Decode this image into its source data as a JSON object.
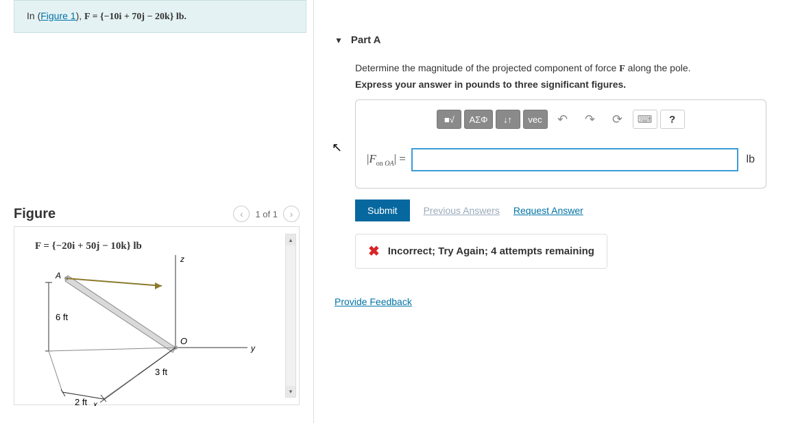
{
  "problem": {
    "prefix": "In (",
    "figure_link": "Figure 1",
    "suffix": "), ",
    "equation": "F = {−10i + 70j − 20k} lb."
  },
  "figure": {
    "title": "Figure",
    "nav": {
      "prev": "‹",
      "count": "1 of 1",
      "next": "›"
    },
    "caption": "F = {−20i + 50j − 10k} lb",
    "labels": {
      "A": "A",
      "O": "O",
      "z": "z",
      "y": "y",
      "x": "x",
      "d6": "6 ft",
      "d3": "3 ft",
      "d2": "2 ft"
    }
  },
  "part": {
    "chevron": "▼",
    "title": "Part A",
    "instruction_text": "Determine the magnitude of the projected component of force ",
    "instruction_F": "F",
    "instruction_tail": " along the pole.",
    "instruction_bold": "Express your answer in pounds to three significant figures.",
    "answer_label": "|F on OA| =",
    "answer_value": "",
    "unit": "lb",
    "toolbar": {
      "templates": "■√",
      "greek": "ΑΣΦ",
      "updown": "↓↑",
      "vec": "vec",
      "undo": "↶",
      "redo": "↷",
      "reset": "⟳",
      "keyboard": "⌨",
      "help": "?"
    },
    "submit": "Submit",
    "prev_answers": "Previous Answers",
    "request_answer": "Request Answer",
    "feedback": {
      "icon": "✖",
      "text": "Incorrect; Try Again; 4 attempts remaining"
    }
  },
  "provide_feedback": "Provide Feedback"
}
